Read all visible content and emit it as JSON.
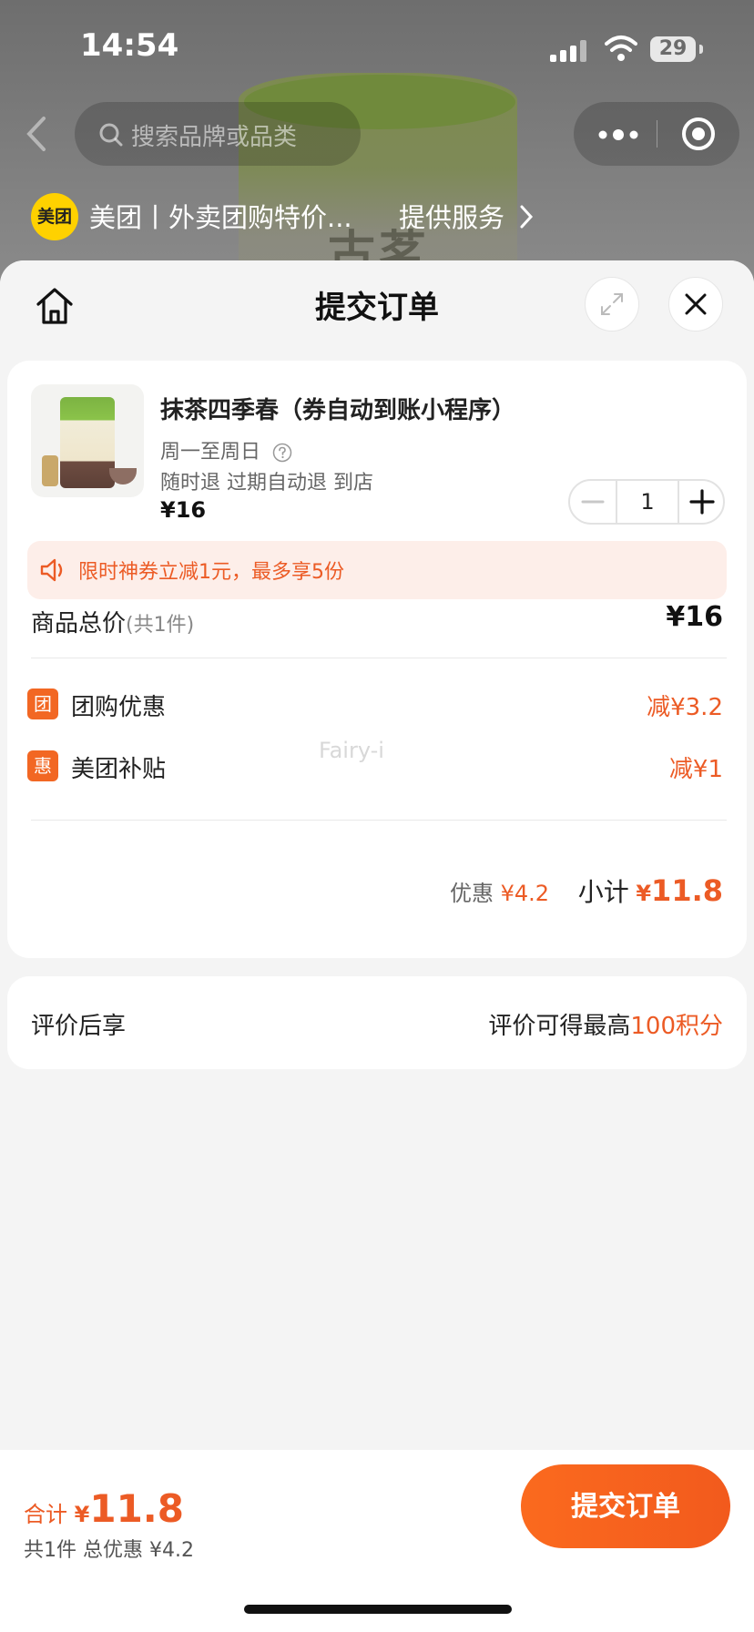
{
  "status_bar": {
    "time": "14:54",
    "battery": "29"
  },
  "search": {
    "placeholder": "搜索品牌或品类"
  },
  "brand": {
    "logo_text": "美团",
    "title": "美团丨外卖团购特价...",
    "service_label": "提供服务"
  },
  "sheet": {
    "title": "提交订单"
  },
  "product": {
    "name": "抹茶四季春（券自动到账小程序）",
    "days": "周一至周日",
    "policy": "随时退 过期自动退 到店",
    "price": "¥16",
    "quantity": "1"
  },
  "promo": {
    "text": "限时神券立减1元，最多享5份"
  },
  "summary": {
    "total_label": "商品总价",
    "total_count": "(共1件)",
    "total_value": "¥16",
    "discounts": [
      {
        "icon": "团",
        "label": "团购优惠",
        "value": "减¥3.2"
      },
      {
        "icon": "惠",
        "label": "美团补贴",
        "value": "减¥1"
      }
    ],
    "discount_label": "优惠",
    "discount_value": "¥4.2",
    "subtotal_label": "小计",
    "subtotal_yen": "¥",
    "subtotal_value": "11.8"
  },
  "watermark": "Fairy-i",
  "review": {
    "left": "评价后享",
    "right_prefix": "评价可得最高",
    "right_points": "100积分"
  },
  "bottom": {
    "total_label": "合计",
    "yen": "¥",
    "amount": "11.8",
    "sub": "共1件 总优惠 ¥4.2",
    "submit": "提交订单"
  },
  "colors": {
    "accent": "#ec5b25",
    "button": "#f25a1d",
    "brand_yellow": "#ffd100"
  },
  "icons": [
    "back-icon",
    "search-icon",
    "more-dots-icon",
    "target-icon",
    "chevron-right-icon",
    "home-icon",
    "expand-icon",
    "close-icon",
    "help-icon",
    "minus-icon",
    "plus-icon",
    "speaker-icon"
  ]
}
